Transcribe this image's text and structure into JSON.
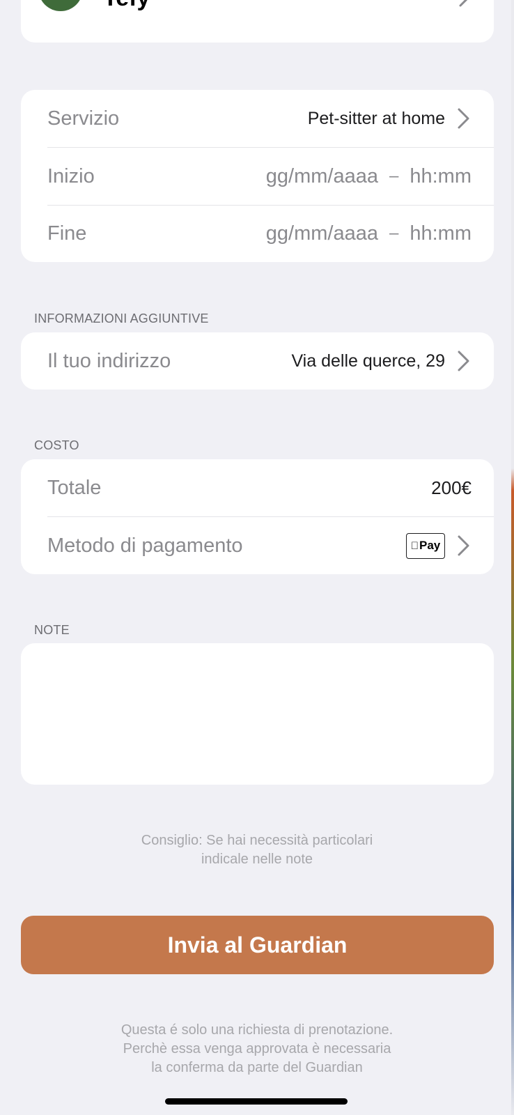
{
  "profile": {
    "name": "Tefy"
  },
  "booking": {
    "service_label": "Servizio",
    "service_value": "Pet-sitter at home",
    "start_label": "Inizio",
    "start_date_placeholder": "gg/mm/aaaa",
    "start_time_placeholder": "hh:mm",
    "end_label": "Fine",
    "end_date_placeholder": "gg/mm/aaaa",
    "end_time_placeholder": "hh:mm",
    "separator": "–"
  },
  "additional_info": {
    "header": "INFORMAZIONI AGGIUNTIVE",
    "address_label": "Il tuo indirizzo",
    "address_value": "Via delle querce, 29"
  },
  "cost": {
    "header": "COSTO",
    "total_label": "Totale",
    "total_value": "200€",
    "payment_label": "Metodo di pagamento",
    "payment_method_text": "Pay",
    "payment_method_icon": "apple-pay-icon"
  },
  "notes": {
    "header": "NOTE",
    "placeholder": ""
  },
  "tip": {
    "line1": "Consiglio: Se hai necessità particolari",
    "line2": "indicale nelle note"
  },
  "submit": {
    "label": "Invia al Guardian",
    "color": "#c4784c"
  },
  "disclaimer": {
    "line1": "Questa é solo una richiesta di prenotazione.",
    "line2": "Perchè essa venga approvata è necessaria",
    "line3": "la conferma da parte del Guardian"
  },
  "colors": {
    "background": "#f0f0f5",
    "card": "#ffffff",
    "accent": "#c4784c"
  }
}
